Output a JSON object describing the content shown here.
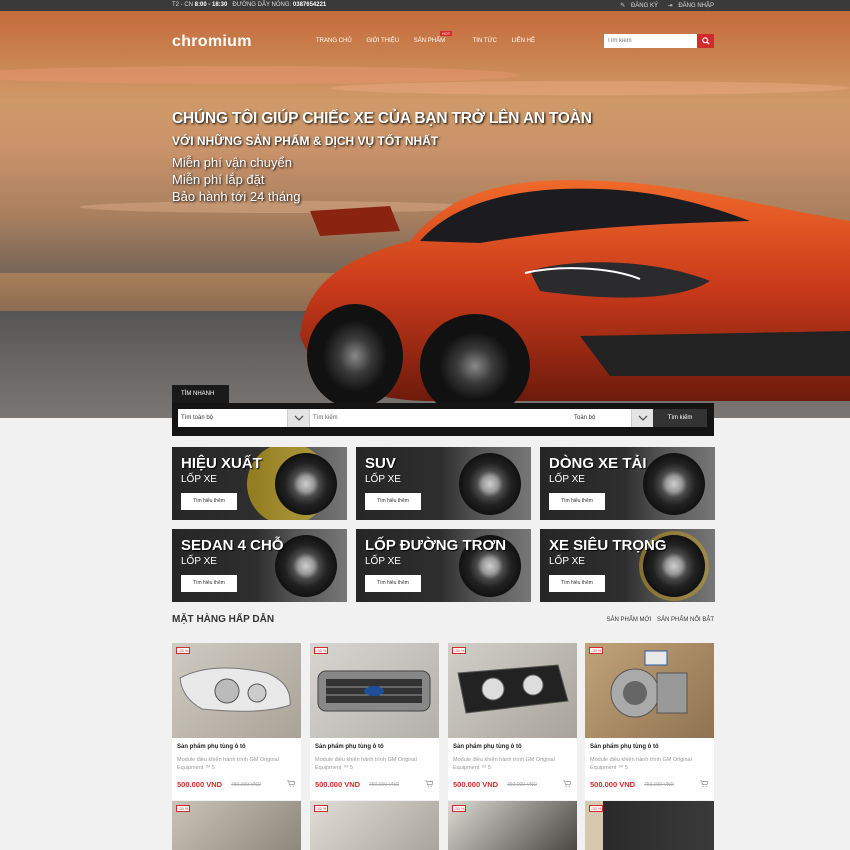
{
  "topbar": {
    "hours": "T2 - CN",
    "time": "8:00 - 18:30",
    "hotline_label": "ĐƯỜNG DÂY NÓNG:",
    "hotline": "0387654221",
    "register": "ĐĂNG KÝ",
    "login": "ĐĂNG NHẬP"
  },
  "header": {
    "logo": "chromium",
    "nav": [
      {
        "label": "Trang chủ"
      },
      {
        "label": "Giới thiệu"
      },
      {
        "label": "Sản phẩm",
        "badge": "HOT"
      },
      {
        "label": "Tin tức"
      },
      {
        "label": "Liên hệ"
      }
    ],
    "search_placeholder": "Tìm kiếm"
  },
  "hero": {
    "title": "CHÚNG TÔI GIÚP CHIẾC XE CỦA BẠN TRỞ LÊN AN TOÀN",
    "subtitle": "VỚI NHỮNG SẢN PHẨM & DỊCH VỤ TỐT NHẤT",
    "features": [
      "Miễn phí vận chuyển",
      "Miễn phí lắp đặt",
      "Bảo hành tới 24 tháng"
    ]
  },
  "quick_search": {
    "tab": "TÌM NHANH",
    "select_all": "Tìm toàn bộ",
    "input_placeholder": "Tìm kiếm",
    "select_scope": "Toàn bộ",
    "button": "Tìm kiếm"
  },
  "categories": [
    {
      "name": "HIỆU XUẤT",
      "sub": "LỐP XE",
      "button": "Tìm hiểu thêm",
      "accent": "#e8c21a"
    },
    {
      "name": "SUV",
      "sub": "LỐP XE",
      "button": "Tìm hiểu thêm",
      "accent": "#8a8a8a"
    },
    {
      "name": "DÒNG XE TẢI",
      "sub": "LỐP XE",
      "button": "Tìm hiểu thêm",
      "accent": "#bdbdbd"
    },
    {
      "name": "SEDAN 4 CHỖ",
      "sub": "LỐP XE",
      "button": "Tìm hiểu thêm",
      "accent": "#c9c9c9"
    },
    {
      "name": "LỐP ĐƯỜNG TRƠN",
      "sub": "LỐP XE",
      "button": "Tìm hiểu thêm",
      "accent": "#9a9a9a"
    },
    {
      "name": "XE SIÊU TRỌNG",
      "sub": "LỐP XE",
      "button": "Tìm hiểu thêm",
      "accent": "#c8a020"
    }
  ],
  "products_section": {
    "title": "MẶT HÀNG HẤP DẪN",
    "tabs": [
      "SẢN PHẨM MỚI",
      "SẢN PHẨM NỔI BẬT"
    ]
  },
  "products": [
    {
      "badge": "-33 %",
      "title": "Sản phẩm phụ tùng ô tô",
      "desc": "Module điều khiển hành trình GM Original Equipment ™ 5",
      "price": "500.000 VND",
      "old_price": "750.000 VND"
    },
    {
      "badge": "-33 %",
      "title": "Sản phẩm phụ tùng ô tô",
      "desc": "Module điều khiển hành trình GM Original Equipment ™ 5",
      "price": "500.000 VND",
      "old_price": "750.000 VND"
    },
    {
      "badge": "-33 %",
      "title": "Sản phẩm phụ tùng ô tô",
      "desc": "Module điều khiển hành trình GM Original Equipment ™ 5",
      "price": "500.000 VND",
      "old_price": "750.000 VND"
    },
    {
      "badge": "-33 %",
      "title": "Sản phẩm phụ tùng ô tô",
      "desc": "Module điều khiển hành trình GM Original Equipment ™ 5",
      "price": "500.000 VND",
      "old_price": "750.000 VND"
    }
  ],
  "products_row2": [
    {
      "badge": "-33 %"
    },
    {
      "badge": "-33 %"
    },
    {
      "badge": "-33 %"
    },
    {
      "badge": "-33 %"
    }
  ],
  "colors": {
    "accent_red": "#d32b2b",
    "dark": "#141414",
    "car": "#c8391a"
  }
}
